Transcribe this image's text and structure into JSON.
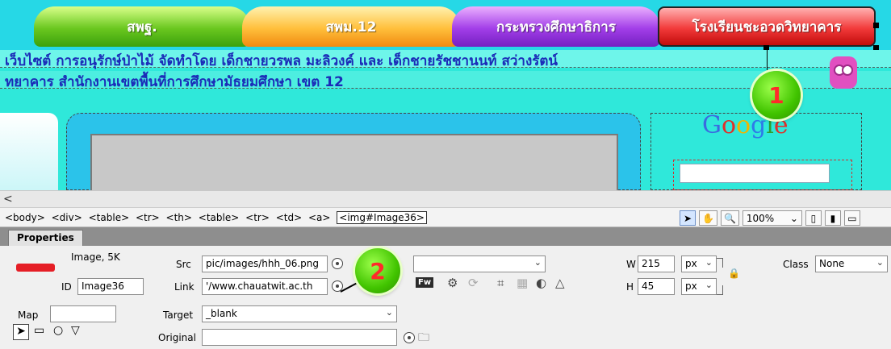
{
  "design_view": {
    "nav_tabs": [
      "สพฐ.",
      "สพม.12",
      "กระทรวงศึกษาธิการ",
      "โรงเรียนชะอวดวิทยาคาร"
    ],
    "marquee_line1": "เว็บไซต์ การอนุรักษ์ป่าไม้ จัดทำโดย เด็กชายวรพล มะลิวงค์ และ เด็กชายรัชชานนท์ สว่างรัตน์",
    "marquee_line2": "ทยาคาร สำนักงานเขตพื้นที่การศึกษามัธยมศึกษา เขต 12",
    "google_logo": "Google",
    "badge1": "1",
    "badge2": "2"
  },
  "scrollbar": {
    "left_arrow": "<"
  },
  "tag_selector": {
    "tags": [
      "<body>",
      "<div>",
      "<table>",
      "<tr>",
      "<th>",
      "<table>",
      "<tr>",
      "<td>",
      "<a>",
      "<img#Image36>"
    ],
    "zoom": "100%"
  },
  "properties": {
    "tab_label": "Properties",
    "type_label": "Image, 5K",
    "id_label": "ID",
    "id_value": "Image36",
    "src_label": "Src",
    "src_value": "pic/images/hhh_06.png",
    "link_label": "Link",
    "link_value": "'/www.chauatwit.ac.th",
    "w_label": "W",
    "w_value": "215",
    "h_label": "H",
    "h_value": "45",
    "unit_w": "px",
    "unit_h": "px",
    "class_label": "Class",
    "class_value": "None",
    "map_label": "Map",
    "target_label": "Target",
    "target_value": "_blank",
    "original_label": "Original",
    "edit_label": "Fw"
  }
}
